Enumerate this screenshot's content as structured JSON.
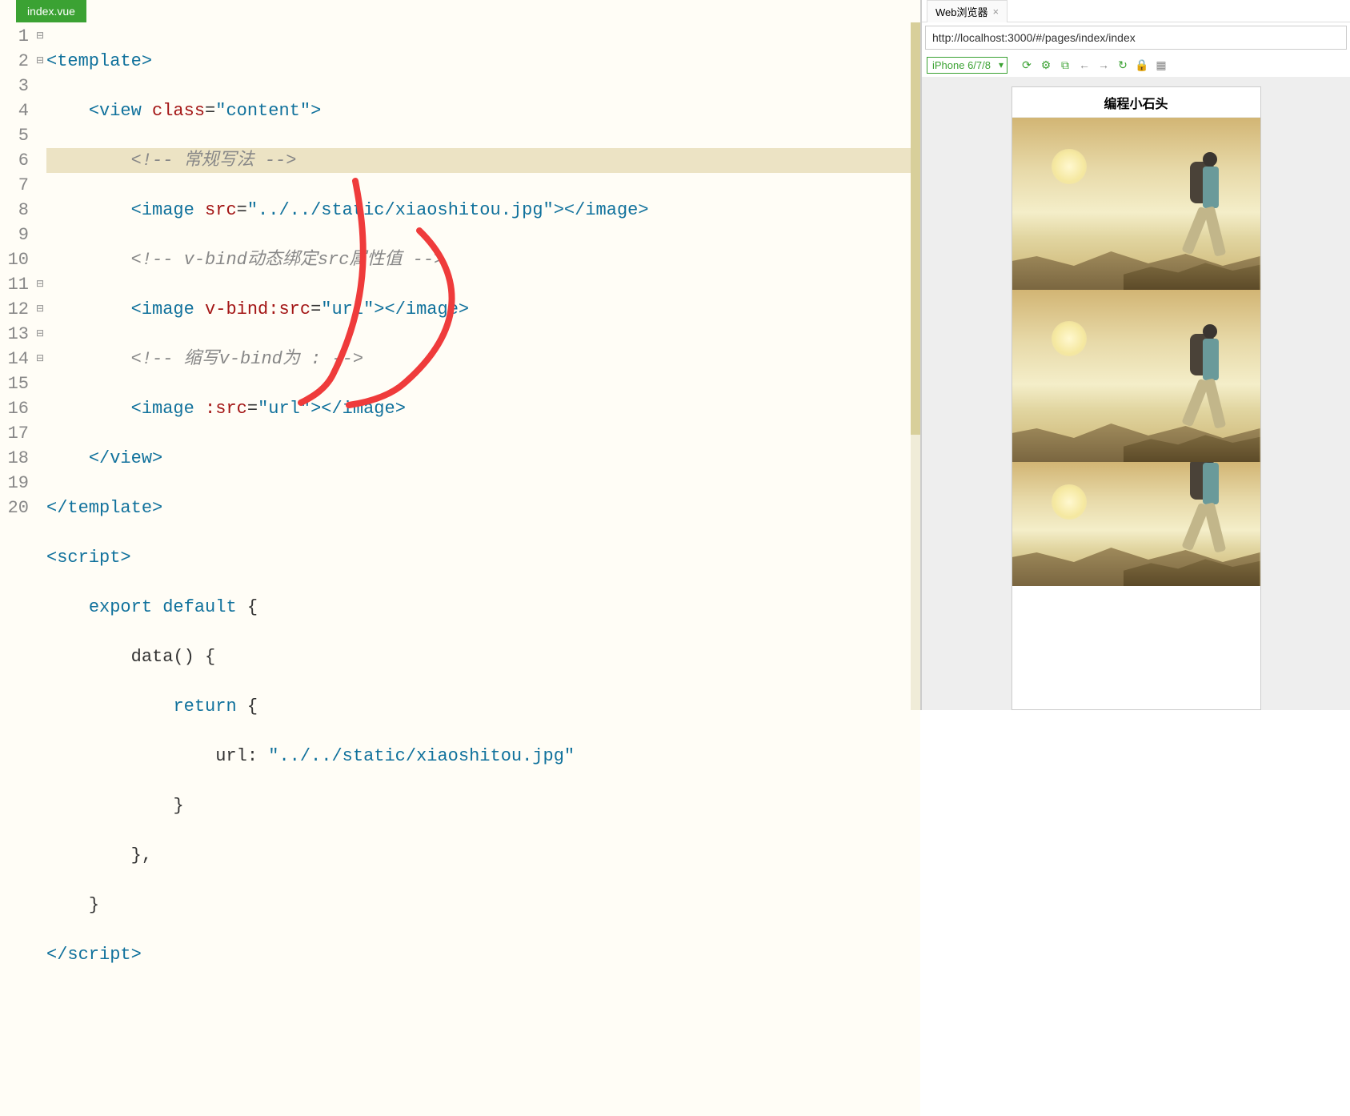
{
  "editor": {
    "tab_label": "index.vue",
    "lines": {
      "1": "1",
      "2": "2",
      "3": "3",
      "4": "4",
      "5": "5",
      "6": "6",
      "7": "7",
      "8": "8",
      "9": "9",
      "10": "10",
      "11": "11",
      "12": "12",
      "13": "13",
      "14": "14",
      "15": "15",
      "16": "16",
      "17": "17",
      "18": "18",
      "19": "19",
      "20": "20"
    },
    "code": {
      "l1_tag_open": "<template>",
      "l2_tag": "<view",
      "l2_attr": " class",
      "l2_eq": "=",
      "l2_str": "\"content\"",
      "l2_close": ">",
      "l3_comment": "<!-- 常规写法 -->",
      "l4_a": "<image",
      "l4_b": " src",
      "l4_c": "=",
      "l4_d": "\"../../static/xiaoshitou.jpg\"",
      "l4_e": "></image>",
      "l5_comment": "<!-- v-bind动态绑定src属性值 -->",
      "l6_a": "<image",
      "l6_b": " v-bind:src",
      "l6_c": "=",
      "l6_d": "\"url\"",
      "l6_e": "></image>",
      "l7_comment": "<!-- 缩写v-bind为 : -->",
      "l8_a": "<image",
      "l8_b": " :src",
      "l8_c": "=",
      "l8_d": "\"url\"",
      "l8_e": "></image>",
      "l9": "</view>",
      "l10": "</template>",
      "l11": "<script>",
      "l12_a": "export",
      "l12_b": " default",
      "l12_c": " {",
      "l13_a": "data()",
      "l13_b": " {",
      "l14_a": "return",
      "l14_b": " {",
      "l15_a": "url:",
      "l15_b": " \"../../static/xiaoshitou.jpg\"",
      "l16": "}",
      "l17": "},",
      "l18": "}",
      "l19": "</script>"
    }
  },
  "preview": {
    "tab_label": "Web浏览器",
    "url": "http://localhost:3000/#/pages/index/index",
    "device": "iPhone 6/7/8",
    "page_title": "编程小石头"
  },
  "fold_marks": {
    "open": "⊟"
  }
}
